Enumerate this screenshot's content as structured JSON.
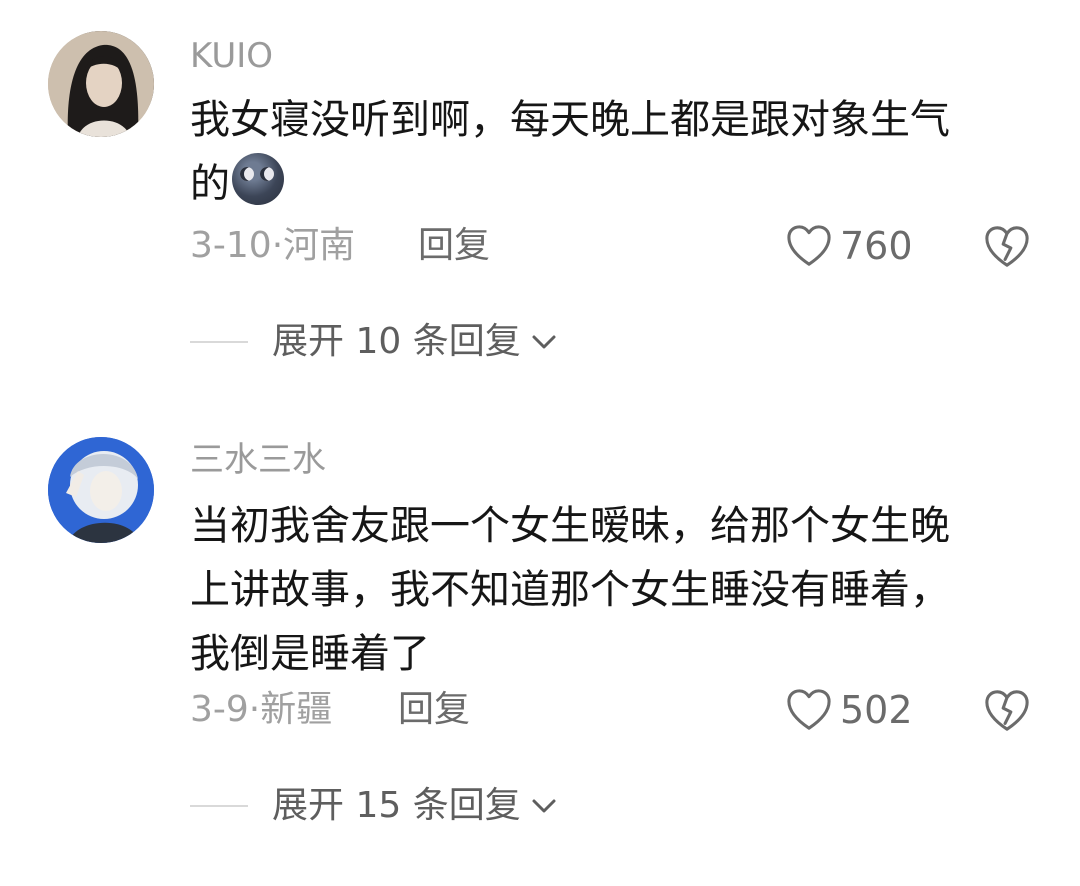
{
  "comments": [
    {
      "username": "KUIO",
      "text": "我女寝没听到啊，每天晚上都是跟对象生气\n的",
      "emoji": "new-moon-face",
      "meta": "3-10·河南",
      "reply_label": "回复",
      "likes": "760",
      "expand_label": "展开 10 条回复"
    },
    {
      "username": "三水三水",
      "text": "当初我舍友跟一个女生暧昧，给那个女生晚\n上讲故事，我不知道那个女生睡没有睡着，\n我倒是睡着了",
      "meta": "3-9·新疆",
      "reply_label": "回复",
      "likes": "502",
      "expand_label": "展开 15 条回复"
    }
  ],
  "colors": {
    "username": "#9a9a9a",
    "text": "#161616",
    "meta": "#a0a0a0",
    "action": "#6b6b6b"
  }
}
